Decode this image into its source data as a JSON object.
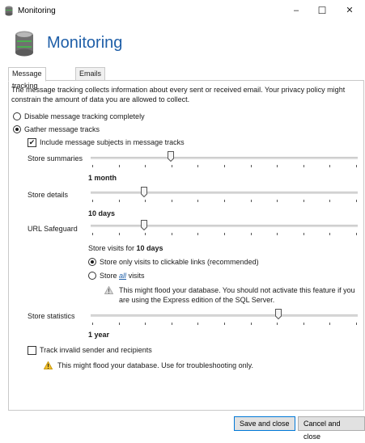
{
  "window": {
    "title": "Monitoring",
    "minimize_glyph": "–",
    "maximize_glyph": "☐",
    "close_glyph": "✕"
  },
  "header": {
    "title": "Monitoring"
  },
  "tabs": [
    {
      "label": "Message tracking",
      "active": true
    },
    {
      "label": "Emails on hold",
      "active": false
    }
  ],
  "message_tracking": {
    "intro_line1": "The message tracking collects information about every sent or received email. Your privacy policy might",
    "intro_line2": "constrain the amount of data you are allowed to collect.",
    "disable_label": "Disable message tracking completely",
    "disable_checked": false,
    "gather_label": "Gather message tracks",
    "gather_checked": true,
    "include_subjects_label": "Include message subjects in message tracks",
    "include_subjects_checked": true,
    "store_summaries": {
      "label": "Store summaries",
      "value": "1 month",
      "level": 0.3
    },
    "store_details": {
      "label": "Store details",
      "value": "10 days",
      "level": 0.2
    },
    "url_safeguard": {
      "label": "URL Safeguard",
      "value_prefix": "Store visits for",
      "value": "10 days",
      "level": 0.2,
      "option_clickable_label": "Store only visits to clickable links (recommended)",
      "option_clickable_checked": true,
      "option_all_prefix": "Store",
      "option_all_link": "all",
      "option_all_suffix": "visits",
      "option_all_checked": false,
      "warning_line1": "This might flood your database. You should not activate this feature if you",
      "warning_line2": "are using the Express edition of the SQL Server."
    },
    "store_statistics": {
      "label": "Store statistics",
      "value": "1 year",
      "level": 0.7
    },
    "track_invalid_label": "Track invalid sender and recipients",
    "track_invalid_checked": false,
    "track_invalid_warning": "This might flood your database. Use for troubleshooting only."
  },
  "footer": {
    "save_label": "Save and close",
    "cancel_label": "Cancel and close"
  },
  "colors": {
    "accent": "#1f5fa8",
    "warning": "#f2c12e",
    "info_warning": "#d8d8d8"
  },
  "icons": {
    "app": "database-icon",
    "warning": "warning-triangle-icon"
  }
}
